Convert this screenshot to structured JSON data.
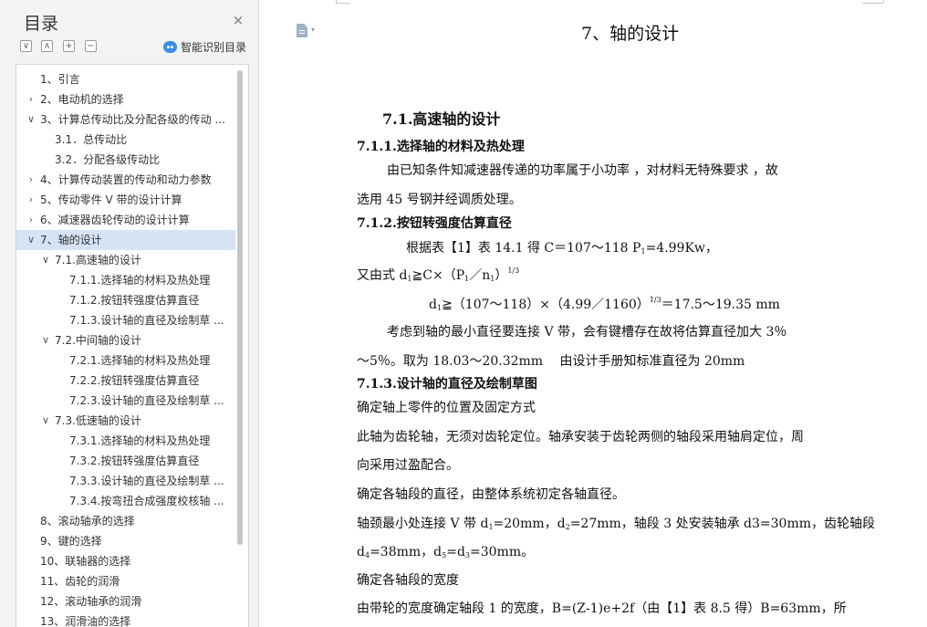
{
  "sidebar": {
    "title": "目录",
    "close_icon": "×",
    "tools": [
      "∨",
      "∧",
      "+",
      "−"
    ],
    "smart_toc_label": "智能识别目录",
    "items": [
      {
        "label": "1、引言",
        "chevron": ""
      },
      {
        "label": "2、电动机的选择",
        "chevron": "›"
      },
      {
        "label": "3、计算总传动比及分配各级的传动 ...",
        "chevron": "∨"
      },
      {
        "label": "3.1．总传动比",
        "chevron": ""
      },
      {
        "label": "3.2．分配各级传动比",
        "chevron": ""
      },
      {
        "label": "4、计算传动装置的传动和动力参数",
        "chevron": "›"
      },
      {
        "label": "5、传动零件 V 带的设计计算",
        "chevron": "›"
      },
      {
        "label": "6、减速器齿轮传动的设计计算",
        "chevron": "›"
      },
      {
        "label": "7、轴的设计",
        "chevron": "∨",
        "selected": true
      },
      {
        "label": "7.1.高速轴的设计",
        "chevron": "∨"
      },
      {
        "label": "7.1.1.选择轴的材料及热处理",
        "chevron": ""
      },
      {
        "label": "7.1.2.按钮转强度估算直径",
        "chevron": ""
      },
      {
        "label": "7.1.3.设计轴的直径及绘制草 ...",
        "chevron": ""
      },
      {
        "label": "7.2.中间轴的设计",
        "chevron": "∨"
      },
      {
        "label": "7.2.1.选择轴的材料及热处理",
        "chevron": ""
      },
      {
        "label": "7.2.2.按钮转强度估算直径",
        "chevron": ""
      },
      {
        "label": "7.2.3.设计轴的直径及绘制草 ...",
        "chevron": ""
      },
      {
        "label": "7.3.低速轴的设计",
        "chevron": "∨"
      },
      {
        "label": "7.3.1.选择轴的材料及热处理",
        "chevron": ""
      },
      {
        "label": "7.3.2.按钮转强度估算直径",
        "chevron": ""
      },
      {
        "label": "7.3.3.设计轴的直径及绘制草 ...",
        "chevron": ""
      },
      {
        "label": "7.3.4.按弯扭合成强度校核轴 ...",
        "chevron": ""
      },
      {
        "label": "8、滚动轴承的选择",
        "chevron": ""
      },
      {
        "label": "9、键的选择",
        "chevron": ""
      },
      {
        "label": "10、联轴器的选择",
        "chevron": ""
      },
      {
        "label": "11、齿轮的润滑",
        "chevron": ""
      },
      {
        "label": "12、滚动轴承的润滑",
        "chevron": ""
      },
      {
        "label": "13、润滑油的选择",
        "chevron": ""
      }
    ]
  },
  "document": {
    "chapter_title": "7、轴的设计",
    "section_title": "7.1.高速轴的设计",
    "s711_heading": "7.1.1.选择轴的材料及热处理",
    "s711_p1": "由已知条件知减速器传递的功率属于小功率 ，对材料无特殊要求 ，故",
    "s711_p2": "选用 45 号钢并经调质处理。",
    "s712_heading": "7.1.2.按钮转强度估算直径",
    "s712_l1": "根据表【1】表 14.1 得 C＝107～118 P",
    "s712_l1_sub": "1",
    "s712_l1_end": "=4.99Kw，",
    "s712_l2": "又由式 d",
    "s712_l2_sub1": "1",
    "s712_l2_mid": "≧C×（P",
    "s712_l2_sub2": "1",
    "s712_l2_mid2": "／n",
    "s712_l2_sub3": "1",
    "s712_l2_end": "）",
    "s712_l2_sup": "1/3",
    "s712_l3": "d",
    "s712_l3_sub": "1",
    "s712_l3_mid": "≧（107～118）×（4.99／1160）",
    "s712_l3_sup": "1/3",
    "s712_l3_end": "＝17.5～19.35 mm",
    "s712_p4": "考虑到轴的最小直径要连接 V 带，会有键槽存在故将估算直径加大 3％",
    "s712_p5": "～5％。取为 18.03～20.32mm　 由设计手册知标准直径为 20mm",
    "s713_heading": "7.1.3.设计轴的直径及绘制草图",
    "s713_p1": "确定轴上零件的位置及固定方式",
    "s713_p2": "此轴为齿轮轴，无须对齿轮定位。轴承安装于齿轮两侧的轴段采用轴肩定位，周",
    "s713_p3": "向采用过盈配合。",
    "s713_p4": "确定各轴段的直径，由整体系统初定各轴直径。",
    "s713_p5a": "轴颈最小处连接 V 带 d",
    "s713_p5_sub1": "1",
    "s713_p5b": "=20mm，d",
    "s713_p5_sub2": "2",
    "s713_p5c": "=27mm，轴段 3 处安装轴承 d3=30mm，齿轮轴段",
    "s713_p6a": "d",
    "s713_p6_sub1": "4",
    "s713_p6b": "=38mm，d",
    "s713_p6_sub2": "5",
    "s713_p6c": "=d",
    "s713_p6_sub3": "3",
    "s713_p6d": "=30mm。",
    "s713_p7": "确定各轴段的宽度",
    "s713_p8": "由带轮的宽度确定轴段 1 的宽度，B=(Z-1)e+2f（由【1】表 8.5 得）B=63mm，所"
  }
}
